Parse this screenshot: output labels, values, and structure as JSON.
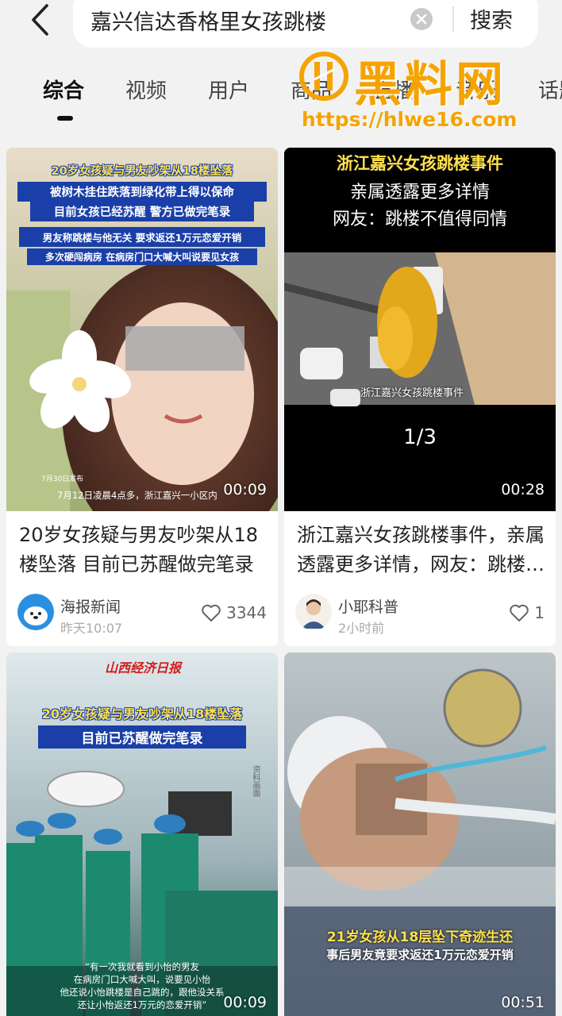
{
  "search": {
    "query": "嘉兴信达香格里女孩跳楼",
    "submit_label": "搜索"
  },
  "tabs": [
    {
      "label": "综合",
      "active": true
    },
    {
      "label": "视频",
      "active": false
    },
    {
      "label": "用户",
      "active": false
    },
    {
      "label": "商品",
      "active": false
    },
    {
      "label": "直播",
      "active": false
    },
    {
      "label": "音乐",
      "active": false
    },
    {
      "label": "话题",
      "active": false
    }
  ],
  "watermark": {
    "title": "黑料网",
    "url": "https://hlwe16.com"
  },
  "cards": [
    {
      "overlay_lines": [
        "20岁女孩疑与男友吵架从18楼坠落",
        "被树木挂住跌落到绿化带上得以保命",
        "目前女孩已经苏醒 警方已做完笔录",
        "男友称跳楼与他无关 要求返还1万元恋爱开销",
        "多次硬闯病房 在病房门口大喊大叫说要见女孩"
      ],
      "date_tag": "7月30日发布",
      "caption": "7月12日凌晨4点多，浙江嘉兴一小区内",
      "duration": "00:09",
      "title": "20岁女孩疑与男友吵架从18楼坠落 目前已苏醒做完笔录",
      "author": "海报新闻",
      "time": "昨天10:07",
      "likes": "3344"
    },
    {
      "overlay_lines": [
        "浙江嘉兴女孩跳楼事件",
        "亲属透露更多详情",
        "网友：跳楼不值得同情"
      ],
      "photo_caption": "浙江嘉兴女孩跳楼事件",
      "counter": "1/3",
      "duration": "00:28",
      "title": "浙江嘉兴女孩跳楼事件，亲属透露更多详情，网友：跳楼不值得同情",
      "author": "小耶科普",
      "time": "2小时前",
      "likes": "1"
    },
    {
      "brand": "山西经济日报",
      "overlay_lines": [
        "20岁女孩疑与男友吵架从18楼坠落",
        "目前已苏醒做完笔录"
      ],
      "file_tag": "资料画面",
      "subtitle_lines": [
        "“有一次我就看到小怡的男友",
        "在病房门口大喊大叫，说要见小怡",
        "他还说小怡跳楼是自己跳的，跟他没关系",
        "还让小怡返还1万元的恋爱开销”"
      ],
      "duration": "00:09"
    },
    {
      "overlay_lines": [
        "21岁女孩从18层坠下奇迹生还",
        "事后男友竟要求返还1万元恋爱开销"
      ],
      "duration": "00:51"
    }
  ],
  "colors": {
    "accent_watermark": "#f5a300",
    "overlay_yellow": "#ffe14d",
    "overlay_blue": "#1a3fa8",
    "page_bg": "#f2f2f2"
  }
}
